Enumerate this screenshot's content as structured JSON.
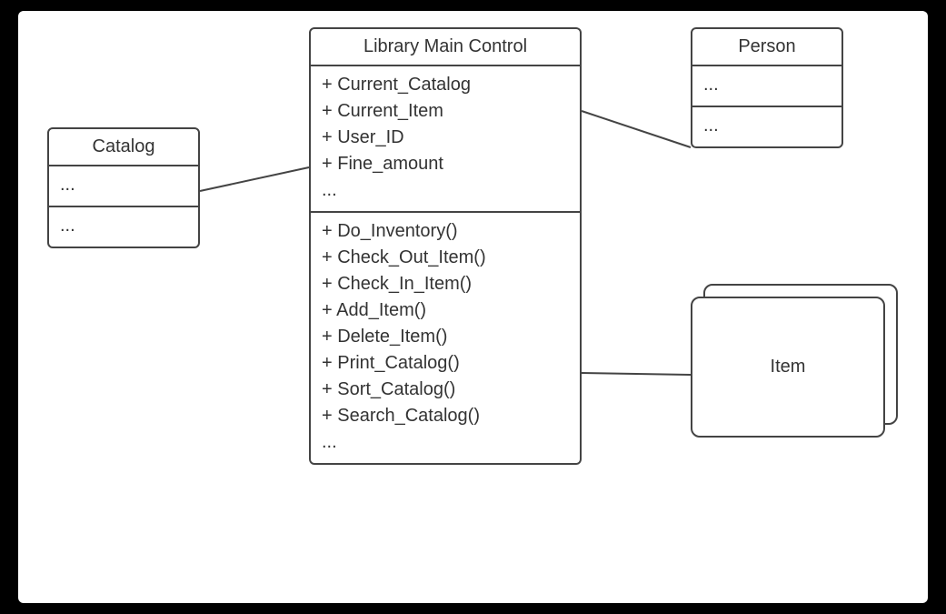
{
  "main": {
    "title": "Library Main Control",
    "attributes": [
      "+ Current_Catalog",
      "+ Current_Item",
      "+ User_ID",
      "+ Fine_amount",
      "..."
    ],
    "operations": [
      "+ Do_Inventory()",
      "+ Check_Out_Item()",
      "+ Check_In_Item()",
      "+ Add_Item()",
      "+ Delete_Item()",
      "+ Print_Catalog()",
      "+ Sort_Catalog()",
      "+ Search_Catalog()",
      "..."
    ]
  },
  "catalog": {
    "title": "Catalog",
    "attributes": [
      "..."
    ],
    "operations": [
      "..."
    ]
  },
  "person": {
    "title": "Person",
    "attributes": [
      "..."
    ],
    "operations": [
      "..."
    ]
  },
  "item": {
    "title": "Item"
  },
  "associations": [
    {
      "from": "catalog",
      "to": "main"
    },
    {
      "from": "main",
      "to": "person"
    },
    {
      "from": "main",
      "to": "item"
    }
  ]
}
